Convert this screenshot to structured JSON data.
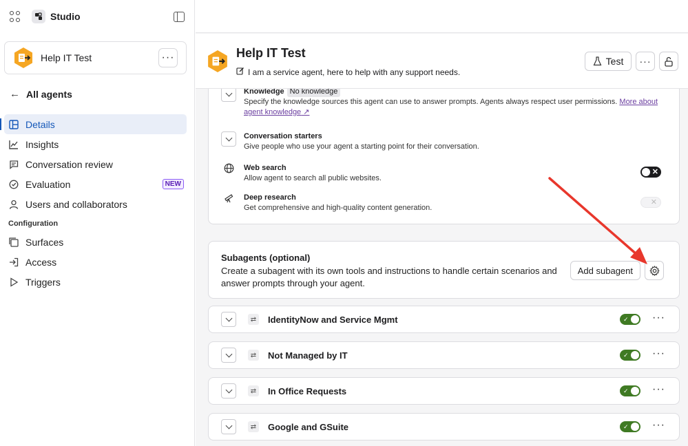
{
  "app": {
    "title": "Studio"
  },
  "agent": {
    "name": "Help IT Test",
    "description": "I am a service agent, here to help with any support needs."
  },
  "sidebar": {
    "back_label": "All agents",
    "items": [
      {
        "label": "Details",
        "icon": "table-icon",
        "active": true
      },
      {
        "label": "Insights",
        "icon": "chart-line-icon"
      },
      {
        "label": "Conversation review",
        "icon": "chat-icon"
      },
      {
        "label": "Evaluation",
        "icon": "check-circle-icon",
        "badge": "NEW"
      },
      {
        "label": "Users and collaborators",
        "icon": "user-icon"
      }
    ],
    "section_label": "Configuration",
    "config_items": [
      {
        "label": "Surfaces",
        "icon": "surfaces-icon"
      },
      {
        "label": "Access",
        "icon": "sign-in-icon"
      },
      {
        "label": "Triggers",
        "icon": "play-icon"
      }
    ]
  },
  "header_actions": {
    "test_label": "Test"
  },
  "tools": {
    "knowledge": {
      "title": "Knowledge",
      "badge": "No knowledge",
      "desc": "Specify the knowledge sources this agent can use to answer prompts. Agents always respect user permissions.",
      "link": "More about agent knowledge"
    },
    "starters": {
      "title": "Conversation starters",
      "desc": "Give people who use your agent a starting point for their conversation."
    },
    "web_search": {
      "title": "Web search",
      "desc": "Allow agent to search all public websites.",
      "enabled": true
    },
    "deep_research": {
      "title": "Deep research",
      "desc": "Get comprehensive and high-quality content generation.",
      "enabled": false
    }
  },
  "subagents": {
    "title": "Subagents (optional)",
    "desc": "Create a subagent with its own tools and instructions to handle certain scenarios and answer prompts through your agent.",
    "add_label": "Add subagent",
    "items": [
      {
        "name": "IdentityNow and Service Mgmt",
        "enabled": true
      },
      {
        "name": "Not Managed by IT",
        "enabled": true
      },
      {
        "name": "In Office Requests",
        "enabled": true
      },
      {
        "name": "Google and GSuite",
        "enabled": true
      }
    ]
  },
  "colors": {
    "accent": "#1457b8",
    "toggle_on": "#3f7a23",
    "agent_logo": "#f5a623",
    "annotation_arrow": "#e8372c"
  }
}
